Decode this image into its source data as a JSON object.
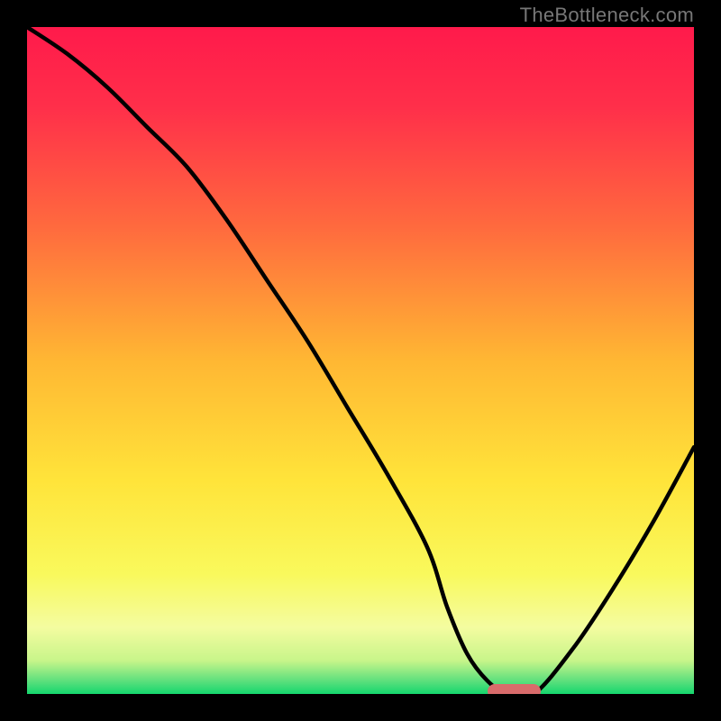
{
  "watermark": "TheBottleneck.com",
  "chart_data": {
    "type": "line",
    "title": "",
    "xlabel": "",
    "ylabel": "",
    "xlim": [
      0,
      100
    ],
    "ylim": [
      0,
      100
    ],
    "x": [
      0,
      6,
      12,
      18,
      24,
      30,
      36,
      42,
      48,
      54,
      60,
      63,
      66,
      69,
      72,
      76,
      82,
      88,
      94,
      100
    ],
    "curve": [
      100,
      96,
      91,
      85,
      79,
      71,
      62,
      53,
      43,
      33,
      22,
      13,
      6,
      2,
      0,
      0,
      7,
      16,
      26,
      37
    ],
    "optimum_marker": {
      "x_center": 73,
      "x_halfwidth": 4,
      "y": 0
    },
    "gradient_stops": [
      {
        "pct": 0,
        "color": "#ff1a4b"
      },
      {
        "pct": 12,
        "color": "#ff2f4a"
      },
      {
        "pct": 30,
        "color": "#ff6a3e"
      },
      {
        "pct": 50,
        "color": "#ffb733"
      },
      {
        "pct": 68,
        "color": "#ffe43a"
      },
      {
        "pct": 82,
        "color": "#f9f95c"
      },
      {
        "pct": 90,
        "color": "#f4fca0"
      },
      {
        "pct": 95,
        "color": "#c8f58a"
      },
      {
        "pct": 98,
        "color": "#5fe07d"
      },
      {
        "pct": 100,
        "color": "#15d66e"
      }
    ]
  }
}
